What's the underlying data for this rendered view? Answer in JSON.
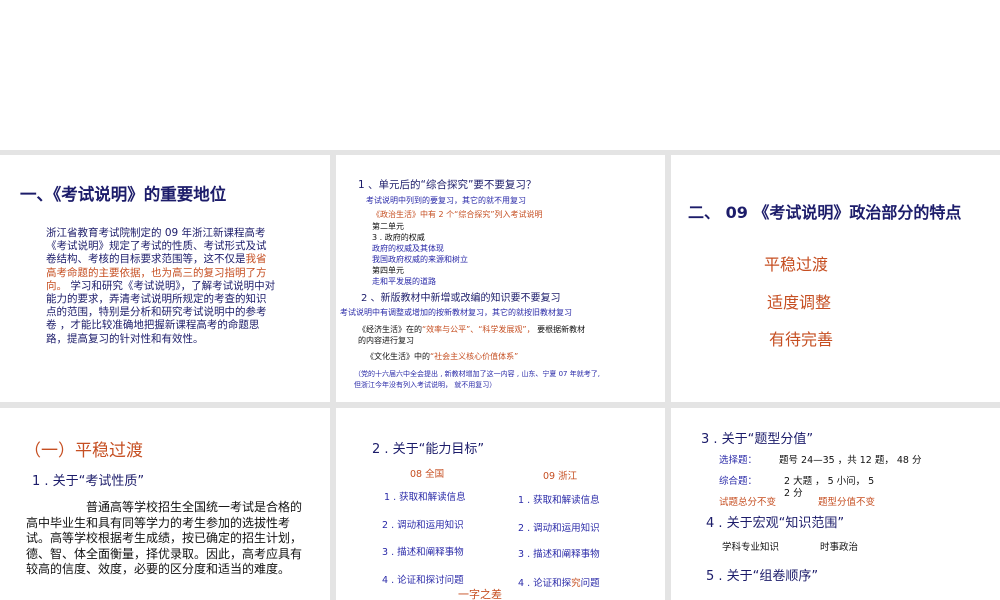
{
  "slide1": {
    "title": "一、《考试说明》的重要地位",
    "p_a": "浙江省教育考试院制定的 09 年浙江新课程高考《考试说明》规定了考试的性质、考试形式及试卷结构、考核的目标要求范围等，这不仅是",
    "p_b": "我省高考命题的主要依据，也为高三的复习指明了方向。",
    "p_c": " 学习和研究《考试说明》，了解考试说明中对能力的要求，弄清考试说明所规定的考查的知识点的范围，特别是分析和研究考试说明中的参考卷 ，才能比较准确地把握新课程高考的命题思路，提高复习的针对性和有效性。"
  },
  "slide2": {
    "q1": "1 、单元后的“综合探究”要不要复习？",
    "l1": "考试说明中列到的要复习，其它的就不用复习",
    "l2": "《政治生活》中有 2 个“综合探究”列入考试说明",
    "l3": "第二单元",
    "l4": "3 . 政府的权威",
    "l5": "政府的权威及其体现",
    "l6": "我国政府权威的来源和树立",
    "l7": "第四单元",
    "l8": "走和平发展的道路",
    "q2": "2 、新版教材中新增或改编的知识要不要复习",
    "m1": "考试说明中有调整或增加的按新教材复习，其它的就按旧教材复习",
    "m2a": "《经济生活》在的",
    "m2b": "“效率与公平”、“科学发展观”，",
    "m2c": " 要根据新教材",
    "m2d": "的内容进行复习",
    "m3a": "《文化生活》中的",
    "m3b": "“社会主义核心价值体系”",
    "m4": "（党的十六届六中全会提出 , 新教材增加了这一内容 , 山东、宁夏 07 年就考了,",
    "m5": "但浙江今年没有列入考试说明，  就不用复习）"
  },
  "slide3": {
    "title": "二、 09 《考试说明》政治部分的特点",
    "items": [
      "平稳过渡",
      "适度调整",
      "有待完善"
    ]
  },
  "slide4": {
    "title": "（一）平稳过渡",
    "sub": "1 . 关于“考试性质”",
    "body": "普通高等学校招生全国统一考试是合格的高中毕业生和具有同等学力的考生参加的选拔性考试。高等学校根据考生成绩，按已确定的招生计划，德、智、体全面衡量，择优录取。因此，高考应具有较高的信度、效度，必要的区分度和适当的难度。"
  },
  "slide5": {
    "title": "2 . 关于“能力目标”",
    "col1_head": "08 全国",
    "col2_head": "09 浙江",
    "col1": [
      "1 . 获取和解读信息",
      "2 . 调动和运用知识",
      "3 . 描述和阐释事物",
      "4 . 论证和探讨问题"
    ],
    "col2": [
      "1 . 获取和解读信息",
      "2 . 调动和运用知识",
      "3 . 描述和阐释事物"
    ],
    "col2_last_a": "4 . 论证和探",
    "col2_last_b": "究",
    "col2_last_c": "问题",
    "note": "一字之差"
  },
  "slide6": {
    "h3": "3 . 关于“题型分值”",
    "xz_label": "选择题：",
    "xz_val": "题号 24—35 ，共 12 题， 48 分",
    "zh_label": "综合题：",
    "zh_val": "2 大题 ，   5 小问， 5",
    "zh_val2": "2 分",
    "n1": "试题总分不变",
    "n2": "题型分值不变",
    "h4": "4 . 关于宏观“知识范围”",
    "k1": "学科专业知识",
    "k2": "时事政治",
    "h5": "5 . 关于“组卷顺序”"
  }
}
